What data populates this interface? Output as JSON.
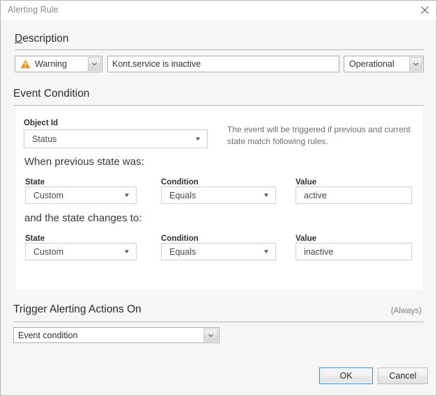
{
  "window": {
    "title": "Alerting Rule",
    "close_icon": "close-icon"
  },
  "description_section": {
    "heading_accel": "D",
    "heading_rest": "escription",
    "severity": {
      "value": "Warning",
      "icon": "warning-triangle-icon"
    },
    "message": {
      "value": "Kont.service is inactive"
    },
    "category": {
      "value": "Operational"
    }
  },
  "event_condition_section": {
    "heading": "Event Condition",
    "object_id": {
      "label": "Object Id",
      "value": "Status"
    },
    "hint": "The event will be triggered if previous and current state match following rules.",
    "previous_state": {
      "heading": "When previous state was:",
      "state_label": "State",
      "state_value": "Custom",
      "condition_label": "Condition",
      "condition_value": "Equals",
      "value_label": "Value",
      "value_value": "active"
    },
    "new_state": {
      "heading": "and the state changes to:",
      "state_label": "State",
      "state_value": "Custom",
      "condition_label": "Condition",
      "condition_value": "Equals",
      "value_label": "Value",
      "value_value": "inactive"
    }
  },
  "trigger_section": {
    "heading": "Trigger Alerting Actions On",
    "note": "(Always)",
    "trigger_value": "Event condition"
  },
  "footer": {
    "ok_label": "OK",
    "cancel_label": "Cancel"
  },
  "colors": {
    "dialog_bg": "#f6f6f6",
    "panel_bg": "#ffffff",
    "warning_orange": "#f09022",
    "accent_blue": "#2a8fd8",
    "title_gray": "#8b8b8b"
  }
}
